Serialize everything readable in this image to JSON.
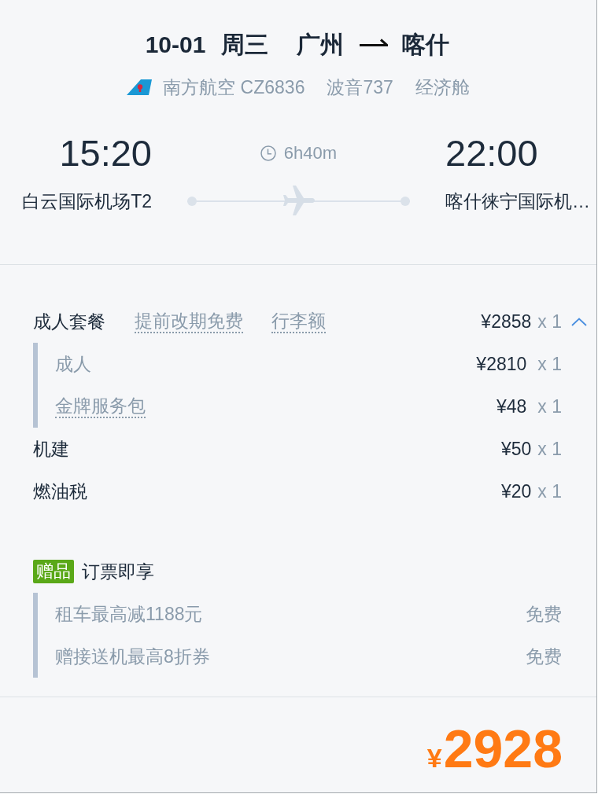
{
  "flight": {
    "date": "10-01",
    "weekday": "周三",
    "origin": "广州",
    "destination": "喀什",
    "airline": "南方航空 CZ6836",
    "aircraft": "波音737",
    "cabin": "经济舱",
    "departure_time": "15:20",
    "arrival_time": "22:00",
    "duration": "6h40m",
    "departure_airport": "白云国际机场T2",
    "arrival_airport": "喀什徕宁国际机…"
  },
  "price_rows": [
    {
      "kind": "package",
      "label": "成人套餐",
      "tags": [
        "提前改期免费",
        "行李额"
      ],
      "price": "¥2858",
      "quantity": "x 1",
      "expanded": true,
      "children": [
        {
          "label": "成人",
          "price": "¥2810",
          "quantity": "x 1",
          "tooltip": false
        },
        {
          "label": "金牌服务包",
          "price": "¥48",
          "quantity": "x 1",
          "tooltip": true
        }
      ]
    },
    {
      "kind": "fee",
      "label": "机建",
      "price": "¥50",
      "quantity": "x 1"
    },
    {
      "kind": "fee",
      "label": "燃油税",
      "price": "¥20",
      "quantity": "x 1"
    }
  ],
  "gift": {
    "badge": "赠品",
    "title": "订票即享",
    "items": [
      {
        "label": "租车最高减1188元",
        "value": "免费"
      },
      {
        "label": "赠接送机最高8折券",
        "value": "免费"
      }
    ]
  },
  "total": {
    "currency": "¥",
    "amount": "2928"
  }
}
